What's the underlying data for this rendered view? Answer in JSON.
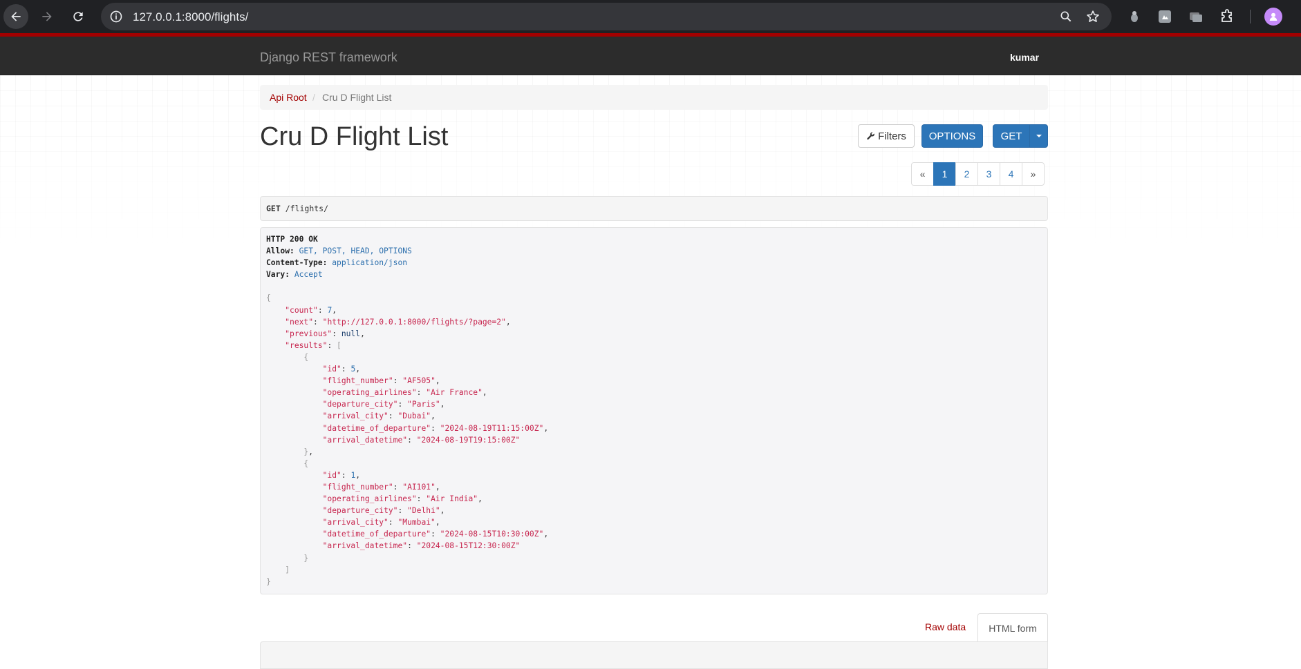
{
  "browser": {
    "url": "127.0.0.1:8000/flights/"
  },
  "navbar": {
    "brand": "Django REST framework",
    "user": "kumar"
  },
  "breadcrumb": {
    "root": "Api Root",
    "separator": "/",
    "current": "Cru D Flight List"
  },
  "page": {
    "title": "Cru D Flight List"
  },
  "buttons": {
    "filters": "Filters",
    "options": "OPTIONS",
    "get": "GET"
  },
  "pagination": {
    "prev": "«",
    "pages": [
      "1",
      "2",
      "3",
      "4"
    ],
    "active_page": "1",
    "next": "»"
  },
  "request": {
    "method": "GET",
    "path": "/flights/"
  },
  "response": {
    "status": "HTTP 200 OK",
    "headers": [
      {
        "key": "Allow:",
        "value": "GET, POST, HEAD, OPTIONS"
      },
      {
        "key": "Content-Type:",
        "value": "application/json"
      },
      {
        "key": "Vary:",
        "value": "Accept"
      }
    ],
    "body": {
      "count": 7,
      "next": "http://127.0.0.1:8000/flights/?page=2",
      "previous": null,
      "results": [
        {
          "id": 5,
          "flight_number": "AF505",
          "operating_airlines": "Air France",
          "departure_city": "Paris",
          "arrival_city": "Dubai",
          "datetime_of_departure": "2024-08-19T11:15:00Z",
          "arrival_datetime": "2024-08-19T19:15:00Z"
        },
        {
          "id": 1,
          "flight_number": "AI101",
          "operating_airlines": "Air India",
          "departure_city": "Delhi",
          "arrival_city": "Mumbai",
          "datetime_of_departure": "2024-08-15T10:30:00Z",
          "arrival_datetime": "2024-08-15T12:30:00Z"
        }
      ]
    }
  },
  "form_tabs": {
    "raw": "Raw data",
    "html": "HTML form"
  }
}
